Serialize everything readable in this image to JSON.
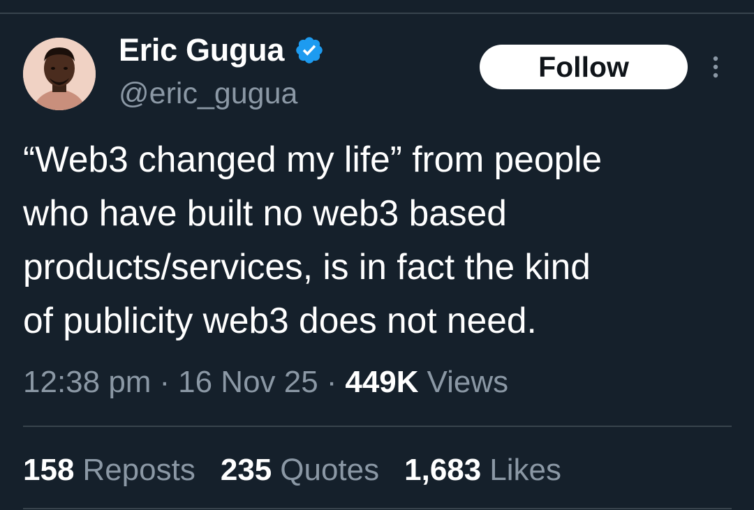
{
  "author": {
    "display_name": "Eric Gugua",
    "handle": "@eric_gugua",
    "verified": true
  },
  "actions": {
    "follow_label": "Follow"
  },
  "tweet": {
    "lines": [
      "“Web3 changed my life” from people",
      "who have built no web3 based",
      "products/services, is in fact the kind",
      "of publicity web3 does not need."
    ]
  },
  "meta": {
    "time": "12:38 pm",
    "separator": "·",
    "date": "16 Nov 25",
    "views_count": "449K",
    "views_label": "Views"
  },
  "stats": [
    {
      "count": "158",
      "label": "Reposts"
    },
    {
      "count": "235",
      "label": "Quotes"
    },
    {
      "count": "1,683",
      "label": "Likes"
    }
  ],
  "colors": {
    "background": "#15202b",
    "text_primary": "#ffffff",
    "text_secondary": "#8b98a5",
    "verified_blue": "#1d9bf0",
    "divider": "#38444d"
  },
  "icons": {
    "verified": "verified-badge-icon",
    "more": "more-options-icon"
  }
}
